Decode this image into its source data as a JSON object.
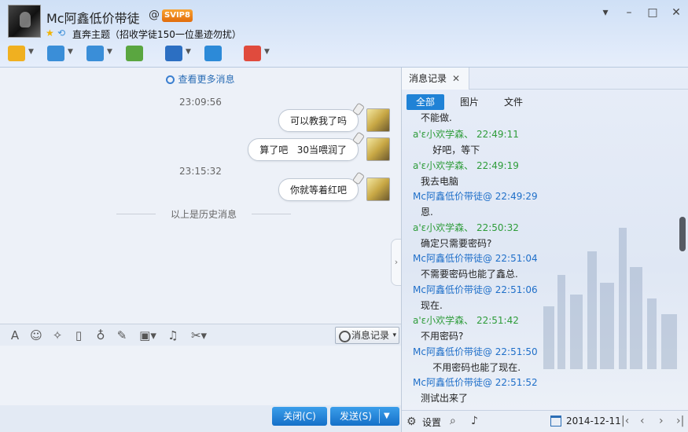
{
  "header": {
    "name": "Mc阿鑫低价带徒",
    "at_symbol": "@",
    "vip_badge": "SVIP8",
    "subtitle": "直奔主题（招收学徒150一位墨迹勿扰）"
  },
  "window_controls": [
    "▾",
    "–",
    "□",
    "✕"
  ],
  "toolbar": [
    {
      "name": "microphone-icon",
      "color": "#f0b020"
    },
    {
      "name": "video-camera-icon",
      "color": "#3a8ed8"
    },
    {
      "name": "file-transfer-icon",
      "color": "#3a8ed8"
    },
    {
      "name": "add-app-icon",
      "color": "#5aa640"
    },
    {
      "name": "remote-desktop-icon",
      "color": "#2c6fc2"
    },
    {
      "name": "screen-share-icon",
      "color": "#2c8ad8"
    },
    {
      "name": "apps-grid-icon",
      "color": "#e04b3d"
    }
  ],
  "chat": {
    "more_messages": "查看更多消息",
    "items": [
      {
        "time": "23:09:56"
      },
      {
        "bubble": "可以教我了吗"
      },
      {
        "bubble": "算了吧   30当喂润了"
      },
      {
        "time": "23:15:32"
      },
      {
        "bubble": "你就等着红吧"
      }
    ],
    "history_divider": "以上是历史消息"
  },
  "input_toolbar": {
    "history_button": "消息记录"
  },
  "bottom": {
    "close_label": "关闭(C)",
    "send_label": "发送(S)"
  },
  "right_panel": {
    "tab_label": "消息记录",
    "filters": [
      "全部",
      "图片",
      "文件"
    ],
    "cutoff_text": "不能做.",
    "entries": [
      {
        "sender": "a'ε小欢学森、 22:49:11",
        "side": "green",
        "text": "    好吧，等下"
      },
      {
        "sender": "a'ε小欢学森、 22:49:19",
        "side": "green",
        "text": "我去电脑"
      },
      {
        "sender": "Mc阿鑫低价带徒@ 22:49:29",
        "side": "blue",
        "text": "恩."
      },
      {
        "sender": "a'ε小欢学森、 22:50:32",
        "side": "green",
        "text": "确定只需要密码?"
      },
      {
        "sender": "Mc阿鑫低价带徒@ 22:51:04",
        "side": "blue",
        "text": "不需要密码也能了鑫总."
      },
      {
        "sender": "Mc阿鑫低价带徒@ 22:51:06",
        "side": "blue",
        "text": "现在."
      },
      {
        "sender": "a'ε小欢学森、 22:51:42",
        "side": "green",
        "text": "不用密码?"
      },
      {
        "sender": "Mc阿鑫低价带徒@ 22:51:50",
        "side": "blue",
        "text": "    不用密码也能了现在."
      },
      {
        "sender": "Mc阿鑫低价带徒@ 22:51:52",
        "side": "blue",
        "text": "测试出来了"
      }
    ],
    "settings_label": "设置",
    "date": "2014-12-11"
  }
}
